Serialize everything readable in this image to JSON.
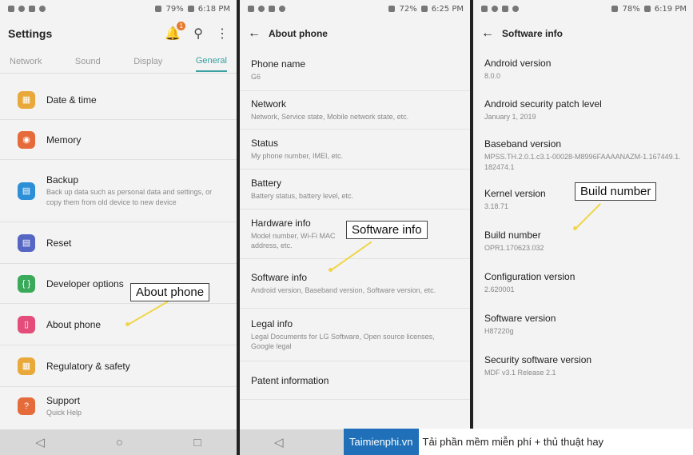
{
  "screen1": {
    "status": {
      "battery": "79%",
      "time": "6:18 PM"
    },
    "title": "Settings",
    "notification_badge": "1",
    "tabs": [
      {
        "label": "Network",
        "active": false
      },
      {
        "label": "Sound",
        "active": false
      },
      {
        "label": "Display",
        "active": false
      },
      {
        "label": "General",
        "active": true
      }
    ],
    "items": [
      {
        "label": "Date & time",
        "sub": "",
        "icon": "calendar-icon",
        "color": "#e9a93a"
      },
      {
        "label": "Memory",
        "sub": "",
        "icon": "memory-icon",
        "color": "#e66b3b"
      },
      {
        "label": "Backup",
        "sub": "Back up data such as personal data and settings, or copy them from old device to new device",
        "icon": "backup-icon",
        "color": "#2d8fd8"
      },
      {
        "label": "Reset",
        "sub": "",
        "icon": "reset-icon",
        "color": "#5566c4"
      },
      {
        "label": "Developer options",
        "sub": "",
        "icon": "developer-icon",
        "color": "#3aaa5a"
      },
      {
        "label": "About phone",
        "sub": "",
        "icon": "info-icon",
        "color": "#e44d7a"
      },
      {
        "label": "Regulatory & safety",
        "sub": "",
        "icon": "regulatory-icon",
        "color": "#e9a93a"
      },
      {
        "label": "Support",
        "sub": "Quick Help",
        "icon": "support-icon",
        "color": "#e66b3b"
      }
    ],
    "callout": "About phone"
  },
  "screen2": {
    "status": {
      "battery": "72%",
      "time": "6:25 PM"
    },
    "title": "About phone",
    "items": [
      {
        "label": "Phone name",
        "sub": "G6"
      },
      {
        "label": "Network",
        "sub": "Network, Service state, Mobile network state, etc."
      },
      {
        "label": "Status",
        "sub": "My phone number, IMEI, etc."
      },
      {
        "label": "Battery",
        "sub": "Battery status, battery level, etc."
      },
      {
        "label": "Hardware info",
        "sub": "Model number, Wi-Fi MAC address, etc."
      },
      {
        "label": "Software info",
        "sub": "Android version, Baseband version, Software version, etc."
      },
      {
        "label": "Legal info",
        "sub": "Legal Documents for LG Software, Open source licenses, Google legal"
      },
      {
        "label": "Patent information",
        "sub": ""
      }
    ],
    "callout": "Software info"
  },
  "screen3": {
    "status": {
      "battery": "78%",
      "time": "6:19 PM"
    },
    "title": "Software info",
    "items": [
      {
        "label": "Android version",
        "sub": "8.0.0"
      },
      {
        "label": "Android security patch level",
        "sub": "January 1, 2019"
      },
      {
        "label": "Baseband version",
        "sub": "MPSS.TH.2.0.1.c3.1-00028-M8996FAAAANAZM-1.167449.1.182474.1"
      },
      {
        "label": "Kernel version",
        "sub": "3.18.71"
      },
      {
        "label": "Build number",
        "sub": "OPR1.170623.032"
      },
      {
        "label": "Configuration version",
        "sub": "2.620001"
      },
      {
        "label": "Software version",
        "sub": "H87220g"
      },
      {
        "label": "Security software version",
        "sub": "MDF v3.1 Release 2.1"
      }
    ],
    "callout": "Build number"
  },
  "watermark": {
    "brand": "Taimienphi.vn",
    "text": "Tải phần mềm miễn phí + thủ thuật hay"
  }
}
